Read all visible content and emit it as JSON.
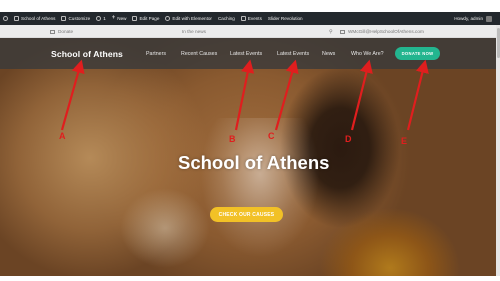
{
  "admin_bar": {
    "site_name": "School of Athens",
    "customize": "Customize",
    "comments_count": "1",
    "new": "New",
    "edit_page": "Edit Page",
    "edit_elementor": "Edit with Elementor",
    "caching": "Caching",
    "events": "Events",
    "slider": "Slider Revolution",
    "howdy": "Howdy, admin"
  },
  "info_bar": {
    "donate": "Donate",
    "news": "In the news",
    "email": "WMcGill@HelpSchoolOfAthens.com"
  },
  "nav": {
    "logo": "School of Athens",
    "items": [
      "Partners",
      "Recent Causes",
      "Latest Events",
      "Latest Events",
      "News",
      "Who We Are?"
    ],
    "donate_button": "DONATE NOW"
  },
  "hero": {
    "headline": "School of Athens",
    "cta": "CHECK OUR CAUSES"
  },
  "annotations": {
    "color": "#e01e1e",
    "labels": [
      "A",
      "B",
      "C",
      "D",
      "E"
    ]
  },
  "colors": {
    "accent_green": "#23b58f",
    "accent_yellow": "#f2c126",
    "admin_bar": "#23282d"
  }
}
